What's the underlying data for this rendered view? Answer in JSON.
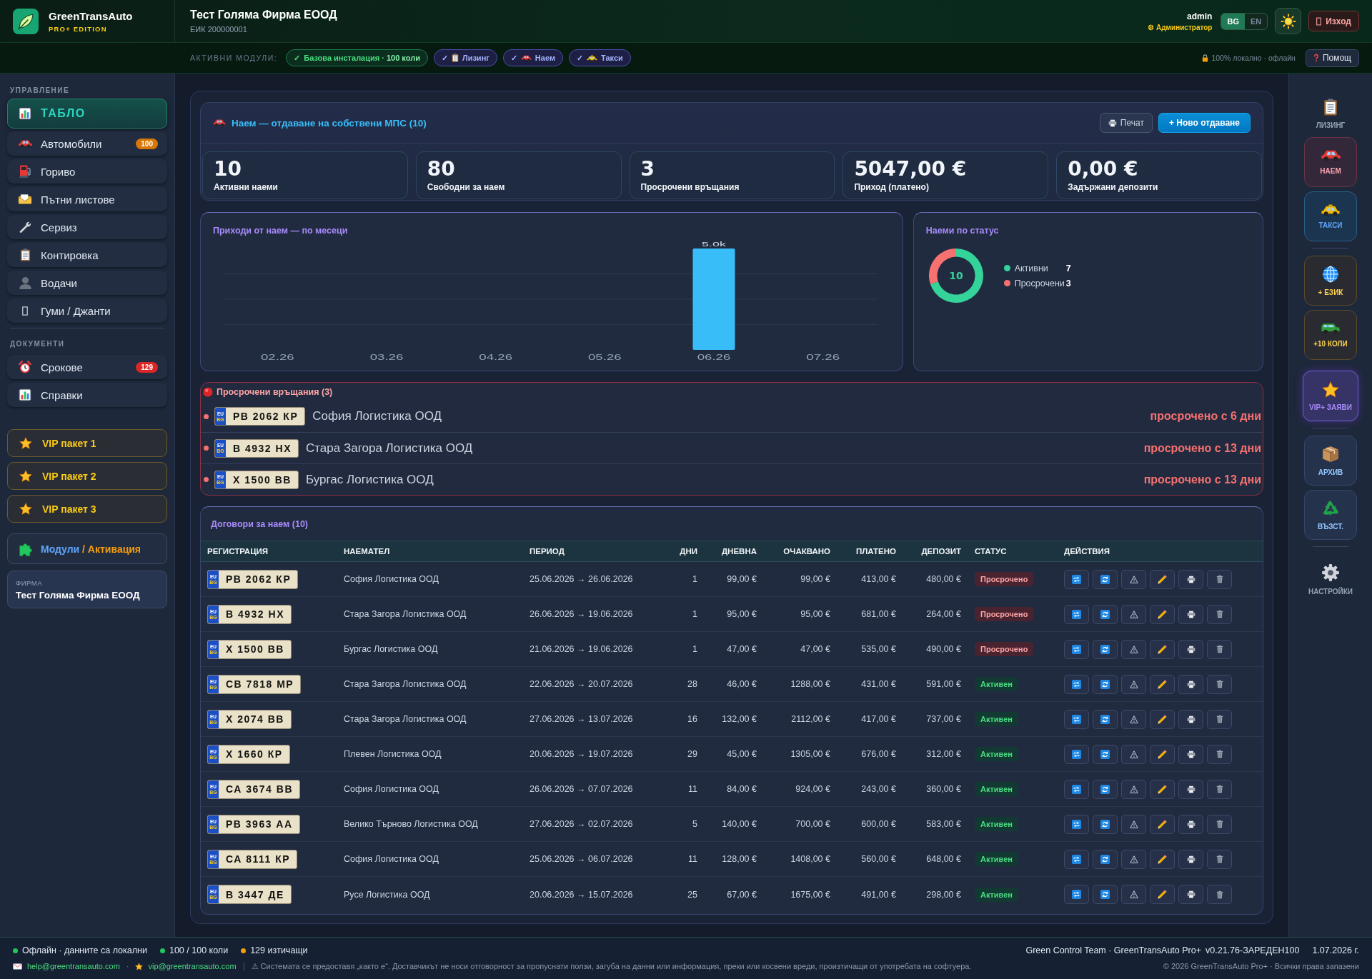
{
  "header": {
    "brand": {
      "name": "GreenTransAuto",
      "edition": "PRO+ EDITION"
    },
    "company": {
      "name": "Тест Голяма Фирма ЕООД",
      "eik": "ЕИК 200000001"
    },
    "user": {
      "name": "admin",
      "role": "⚙ Администратор"
    },
    "languages": [
      {
        "label": "BG",
        "selected": true
      },
      {
        "label": "EN",
        "selected": false
      }
    ],
    "logout": "Изход"
  },
  "modules_bar": {
    "label": "АКТИВНИ МОДУЛИ:",
    "modules": [
      {
        "check": "✓",
        "label": "Базова инсталация · **100 коли**",
        "kind": "base"
      },
      {
        "check": "✓",
        "label": "Лизинг",
        "kind": "addon"
      },
      {
        "check": "✓",
        "label": "Наем",
        "kind": "addon"
      },
      {
        "check": "✓",
        "label": "Такси",
        "kind": "addon"
      }
    ],
    "status": "100% локално · офлайн",
    "help": "Помощ"
  },
  "sidebar": {
    "sections": [
      {
        "title": "УПРАВЛЕНИЕ",
        "items": [
          {
            "label": "ТАБЛО",
            "selected": true
          },
          {
            "label": "Автомобили",
            "selected": false,
            "badge": {
              "text": "100",
              "color": "#d97706"
            }
          },
          {
            "label": "Гориво",
            "selected": false
          },
          {
            "label": "Пътни листове",
            "selected": false
          },
          {
            "label": "Сервиз",
            "selected": false
          },
          {
            "label": "Контировка",
            "selected": false
          },
          {
            "label": "Водачи",
            "selected": false
          },
          {
            "label": "Гуми / Джанти",
            "selected": false
          }
        ]
      },
      {
        "title": "ДОКУМЕНТИ",
        "items": [
          {
            "label": "Срокове",
            "selected": false,
            "badge": {
              "text": "129",
              "color": "#dc2626"
            }
          },
          {
            "label": "Справки",
            "selected": false
          }
        ]
      }
    ],
    "vip_packages": [
      "VIP пакет 1",
      "VIP пакет 2",
      "VIP пакет 3"
    ],
    "modules_link": {
      "primary": "Модули",
      "secondary": "/ Активация"
    },
    "company_card": {
      "label": "ФИРМА",
      "name": "Тест Голяма Фирма ЕООД"
    }
  },
  "rental": {
    "title": "Наем — отдаване на собствени МПС (10)",
    "print_button": "Печат",
    "new_button": "+ Ново отдаване",
    "stats": [
      {
        "value": "10",
        "label": "Активни наеми"
      },
      {
        "value": "80",
        "label": "Свободни за наем"
      },
      {
        "value": "3",
        "label": "Просрочени връщания"
      },
      {
        "value": "5047,00 €",
        "label": "Приход (платено)"
      },
      {
        "value": "0,00 €",
        "label": "Задържани депозити"
      }
    ]
  },
  "revenue_chart": {
    "title": "Приходи от наем — по месеци",
    "chart_data": {
      "type": "bar",
      "categories": [
        "02.26",
        "03.26",
        "04.26",
        "05.26",
        "06.26",
        "07.26"
      ],
      "values": [
        0,
        0,
        0,
        0,
        5000,
        0
      ],
      "value_labels": [
        null,
        null,
        null,
        null,
        "5.0k",
        null
      ]
    }
  },
  "status_chart": {
    "title": "Наеми по статус",
    "chart_data": {
      "type": "donut",
      "categories": [
        "Активни",
        "Просрочени"
      ],
      "values": [
        7,
        3
      ],
      "value_labels": [
        "7",
        "3"
      ],
      "annotations": [
        "10"
      ],
      "legend": "right"
    },
    "slices": [
      {
        "color": "#34d399"
      },
      {
        "color": "#f87171"
      }
    ]
  },
  "overdue": {
    "title": "Просрочени връщания (3)",
    "rows": [
      {
        "plate": {
          "union": "EU",
          "country": "BG",
          "number": "РВ 2062 КР"
        },
        "tenant": "София Логистика ООД",
        "overdue": "просрочено с 6 дни"
      },
      {
        "plate": {
          "union": "EU",
          "country": "BG",
          "number": "В 4932 НХ"
        },
        "tenant": "Стара Загора Логистика ООД",
        "overdue": "просрочено с 13 дни"
      },
      {
        "plate": {
          "union": "EU",
          "country": "BG",
          "number": "Х 1500 ВВ"
        },
        "tenant": "Бургас Логистика ООД",
        "overdue": "просрочено с 13 дни"
      }
    ]
  },
  "contracts": {
    "title": "Договори за наем (10)",
    "columns": [
      "РЕГИСТРАЦИЯ",
      "НАЕМАТЕЛ",
      "ПЕРИОД",
      "ДНИ",
      "ДНЕВНА",
      "ОЧАКВАНО",
      "ПЛАТЕНО",
      "ДЕПОЗИТ",
      "СТАТУС",
      "ДЕЙСТВИЯ"
    ],
    "rows": [
      {
        "plate": {
          "union": "EU",
          "country": "BG",
          "number": "РВ 2062 КР"
        },
        "tenant": "София Логистика ООД",
        "period": "25.06.2026 → 26.06.2026",
        "days": "1",
        "daily": "99,00 €",
        "expected": "99,00 €",
        "paid": "413,00 €",
        "deposit": "480,00 €",
        "status": {
          "label": "Просрочено",
          "kind": "overdue"
        }
      },
      {
        "plate": {
          "union": "EU",
          "country": "BG",
          "number": "В 4932 НХ"
        },
        "tenant": "Стара Загора Логистика ООД",
        "period": "26.06.2026 → 19.06.2026",
        "days": "1",
        "daily": "95,00 €",
        "expected": "95,00 €",
        "paid": "681,00 €",
        "deposit": "264,00 €",
        "status": {
          "label": "Просрочено",
          "kind": "overdue"
        }
      },
      {
        "plate": {
          "union": "EU",
          "country": "BG",
          "number": "Х 1500 ВВ"
        },
        "tenant": "Бургас Логистика ООД",
        "period": "21.06.2026 → 19.06.2026",
        "days": "1",
        "daily": "47,00 €",
        "expected": "47,00 €",
        "paid": "535,00 €",
        "deposit": "490,00 €",
        "status": {
          "label": "Просрочено",
          "kind": "overdue"
        }
      },
      {
        "plate": {
          "union": "EU",
          "country": "BG",
          "number": "СВ 7818 МР"
        },
        "tenant": "Стара Загора Логистика ООД",
        "period": "22.06.2026 → 20.07.2026",
        "days": "28",
        "daily": "46,00 €",
        "expected": "1288,00 €",
        "paid": "431,00 €",
        "deposit": "591,00 €",
        "status": {
          "label": "Активен",
          "kind": "active"
        }
      },
      {
        "plate": {
          "union": "EU",
          "country": "BG",
          "number": "Х 2074 ВВ"
        },
        "tenant": "Стара Загора Логистика ООД",
        "period": "27.06.2026 → 13.07.2026",
        "days": "16",
        "daily": "132,00 €",
        "expected": "2112,00 €",
        "paid": "417,00 €",
        "deposit": "737,00 €",
        "status": {
          "label": "Активен",
          "kind": "active"
        }
      },
      {
        "plate": {
          "union": "EU",
          "country": "BG",
          "number": "Х 1660 КР"
        },
        "tenant": "Плевен Логистика ООД",
        "period": "20.06.2026 → 19.07.2026",
        "days": "29",
        "daily": "45,00 €",
        "expected": "1305,00 €",
        "paid": "676,00 €",
        "deposit": "312,00 €",
        "status": {
          "label": "Активен",
          "kind": "active"
        }
      },
      {
        "plate": {
          "union": "EU",
          "country": "BG",
          "number": "СА 3674 ВВ"
        },
        "tenant": "София Логистика ООД",
        "period": "26.06.2026 → 07.07.2026",
        "days": "11",
        "daily": "84,00 €",
        "expected": "924,00 €",
        "paid": "243,00 €",
        "deposit": "360,00 €",
        "status": {
          "label": "Активен",
          "kind": "active"
        }
      },
      {
        "plate": {
          "union": "EU",
          "country": "BG",
          "number": "РВ 3963 АА"
        },
        "tenant": "Велико Търново Логистика ООД",
        "period": "27.06.2026 → 02.07.2026",
        "days": "5",
        "daily": "140,00 €",
        "expected": "700,00 €",
        "paid": "600,00 €",
        "deposit": "583,00 €",
        "status": {
          "label": "Активен",
          "kind": "active"
        }
      },
      {
        "plate": {
          "union": "EU",
          "country": "BG",
          "number": "СА 8111 КР"
        },
        "tenant": "София Логистика ООД",
        "period": "25.06.2026 → 06.07.2026",
        "days": "11",
        "daily": "128,00 €",
        "expected": "1408,00 €",
        "paid": "560,00 €",
        "deposit": "648,00 €",
        "status": {
          "label": "Активен",
          "kind": "active"
        }
      },
      {
        "plate": {
          "union": "EU",
          "country": "BG",
          "number": "В 3447 ДЕ"
        },
        "tenant": "Русе Логистика ООД",
        "period": "20.06.2026 → 15.07.2026",
        "days": "25",
        "daily": "67,00 €",
        "expected": "1675,00 €",
        "paid": "491,00 €",
        "deposit": "298,00 €",
        "status": {
          "label": "Активен",
          "kind": "active"
        }
      }
    ]
  },
  "quick_panel": {
    "groups": [
      {
        "items": [
          {
            "label": "ЛИЗИНГ",
            "kind": "plain"
          },
          {
            "label": "НАЕМ",
            "kind": "rent"
          },
          {
            "label": "ТАКСИ",
            "kind": "taxi"
          }
        ]
      },
      {
        "items": [
          {
            "label": "+ ЕЗИК",
            "kind": "addon"
          },
          {
            "label": "+10 КОЛИ",
            "kind": "addon"
          },
          {
            "label": "VIP+ ЗАЯВИ",
            "kind": "vip"
          }
        ]
      },
      {
        "items": [
          {
            "label": "АРХИВ",
            "kind": "tool"
          },
          {
            "label": "ВЪЗСТ.",
            "kind": "tool"
          }
        ]
      },
      {
        "items": [
          {
            "label": "НАСТРОЙКИ",
            "kind": "plain"
          }
        ]
      }
    ]
  },
  "status_bar": {
    "indicators": [
      {
        "text": "Офлайн · данните са локални",
        "color": "#22c55e"
      },
      {
        "text": "100 / 100 коли",
        "color": "#22c55e"
      },
      {
        "text": "129 изтичащи",
        "color": "#f59e0b"
      }
    ],
    "credits": "Green Control Team · GreenTransAuto Pro+",
    "version": "v0.21.76-ЗАРЕДЕН100",
    "date": "1.07.2026 г.",
    "help_email": "help@greentransauto.com",
    "separator": "·",
    "vip_email": "vip@greentransauto.com",
    "disclaimer": "⚠ Системата се предоставя „както е“. Доставчикът не носи отговорност за пропуснати ползи, загуба на данни или информация, преки или косвени вреди, произтичащи от употребата на софтуера.",
    "copyright": "© 2026 GreenTransAuto Pro+ · Всички права запазени"
  }
}
